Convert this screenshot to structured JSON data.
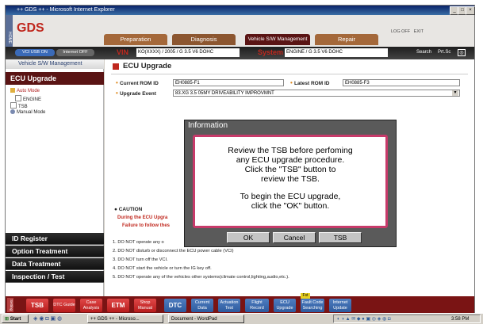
{
  "window": {
    "title": "++ GDS ++ - Microsoft Internet Explorer"
  },
  "header": {
    "home_label": "HOME",
    "logo_text": "GDS",
    "tabs": [
      "Preparation",
      "Diagnosis",
      "Vehicle S/W Management",
      "Repair"
    ],
    "log_off": "LOG OFF",
    "exit": "EXIT",
    "vin_label": "VIN",
    "vin_value": "KO(XXXX) / 2005 / G 3.5 V6 DOHC",
    "system_label": "System",
    "system_value": "ENGINE / G 3.5 V6 DOHC",
    "search": "Search",
    "prtsc": "Prt.Sc",
    "vci_status": "VCI USB ON",
    "internet_status": "Internet OFF"
  },
  "sidebar": {
    "section_label": "Vehicle S/W Management",
    "heading": "ECU Upgrade",
    "tree": [
      "Auto Mode",
      "ENGINE",
      "TSB",
      "Manual Mode"
    ],
    "nav": [
      "ID Register",
      "Option Treatment",
      "Data Treatment",
      "Inspection / Test"
    ]
  },
  "main": {
    "title": "ECU Upgrade",
    "current_rom_label": "Current ROM ID",
    "current_rom_value": "EH0885-F1",
    "latest_rom_label": "Latest ROM ID",
    "latest_rom_value": "EH0885-F3",
    "upgrade_event_label": "Upgrade Event",
    "upgrade_event_value": "83.XG 3.5 05MY DRIVEABILITY IMPROVMNT",
    "caution_title": "CAUTION",
    "caution_line1": "During the ECU Upgra",
    "caution_line2": "Failure to follow thes",
    "notes": [
      "1. DO NOT operate any o",
      "2. DO NOT disturb or disconnect the ECU power cable (VCI)",
      "3. DO NOT turn off the VCI.",
      "4. DO NOT start the vehicle or turn the IG key off.",
      "5. DO NOT operate any of the vehicles other systems(climate control,lighting,audio,etc.)."
    ]
  },
  "dialog": {
    "title": "Information",
    "line1": "Review the TSB before perfoming",
    "line2": "any ECU upgrade procedure.",
    "line3": "Click the \"TSB\" button to",
    "line4": "review the TSB.",
    "line5": "To begin the ECU upgrade,",
    "line6": "click the \"OK\" button.",
    "ok": "OK",
    "cancel": "Cancel",
    "tsb": "TSB"
  },
  "toolbar": {
    "setting": "Setting",
    "buttons": [
      "TSB",
      "DTC Guide",
      "Case Analysis",
      "ETM",
      "Shop Manual",
      "DTC",
      "Current Data",
      "Actuation Test",
      "Flight Record",
      "ECU Upgrade",
      "Fault Code Searching",
      "Internet Update"
    ],
    "new_badge": "Fst"
  },
  "taskbar": {
    "start": "Start",
    "tasks": [
      "++ GDS ++ - Microso...",
      "Document - WordPad"
    ],
    "clock": "3:58 PM"
  }
}
